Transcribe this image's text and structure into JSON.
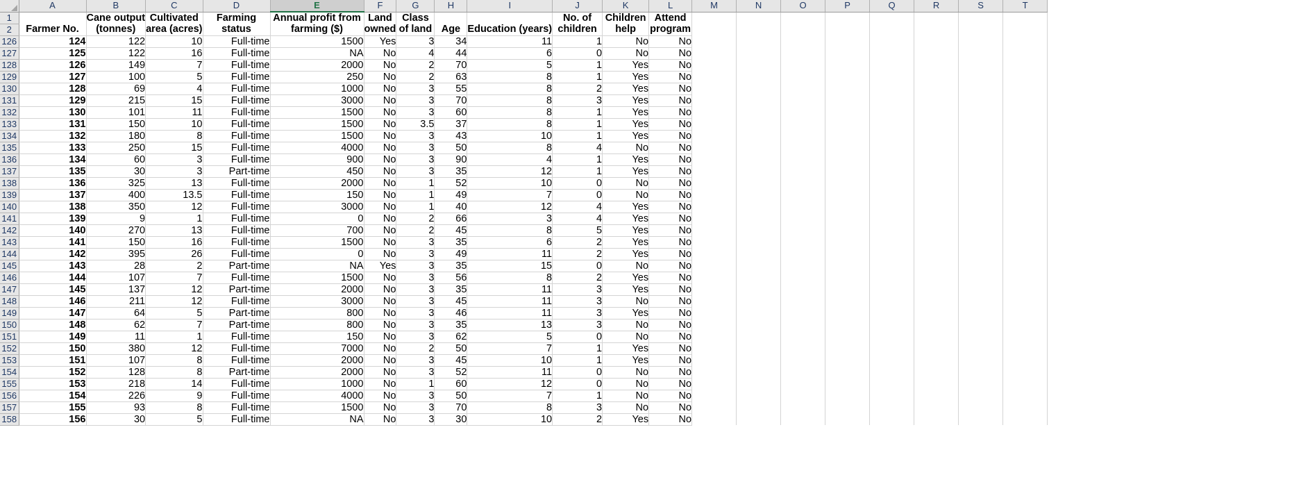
{
  "app": {
    "type": "spreadsheet",
    "select_all_icon": "select-all-triangle-icon",
    "selected_column": "E"
  },
  "columns": {
    "letters": [
      "A",
      "B",
      "C",
      "D",
      "E",
      "F",
      "G",
      "H",
      "I",
      "J",
      "K",
      "L",
      "M",
      "N",
      "O",
      "P",
      "Q",
      "R",
      "S",
      "T"
    ],
    "widths": [
      97,
      82,
      81,
      97,
      135,
      45,
      55,
      47,
      113,
      72,
      67,
      62,
      64,
      64,
      64,
      64,
      64,
      64,
      64,
      64
    ]
  },
  "header_rows": {
    "row1_number": "1",
    "row2_number": "2",
    "row1": [
      "",
      "Cane output",
      "Cultivated",
      "Farming",
      "Annual profit from",
      "Land",
      "Class",
      "",
      "",
      "No. of",
      "Children",
      "Attend"
    ],
    "row2": [
      "Farmer No.",
      "(tonnes)",
      "area (acres)",
      "status",
      "farming ($)",
      "owned",
      "of land",
      "Age",
      "Education (years)",
      "children",
      "help",
      "program"
    ]
  },
  "table": {
    "row_numbers": [
      "126",
      "127",
      "128",
      "129",
      "130",
      "131",
      "132",
      "133",
      "134",
      "135",
      "136",
      "137",
      "138",
      "139",
      "140",
      "141",
      "142",
      "143",
      "144",
      "145",
      "146",
      "147",
      "148",
      "149",
      "150",
      "151",
      "152",
      "153",
      "154",
      "155",
      "156",
      "157",
      "158"
    ],
    "rows": [
      [
        "124",
        "122",
        "10",
        "Full-time",
        "1500",
        "Yes",
        "3",
        "34",
        "11",
        "1",
        "No",
        "No"
      ],
      [
        "125",
        "122",
        "16",
        "Full-time",
        "NA",
        "No",
        "4",
        "44",
        "6",
        "0",
        "No",
        "No"
      ],
      [
        "126",
        "149",
        "7",
        "Full-time",
        "2000",
        "No",
        "2",
        "70",
        "5",
        "1",
        "Yes",
        "No"
      ],
      [
        "127",
        "100",
        "5",
        "Full-time",
        "250",
        "No",
        "2",
        "63",
        "8",
        "1",
        "Yes",
        "No"
      ],
      [
        "128",
        "69",
        "4",
        "Full-time",
        "1000",
        "No",
        "3",
        "55",
        "8",
        "2",
        "Yes",
        "No"
      ],
      [
        "129",
        "215",
        "15",
        "Full-time",
        "3000",
        "No",
        "3",
        "70",
        "8",
        "3",
        "Yes",
        "No"
      ],
      [
        "130",
        "101",
        "11",
        "Full-time",
        "1500",
        "No",
        "3",
        "60",
        "8",
        "1",
        "Yes",
        "No"
      ],
      [
        "131",
        "150",
        "10",
        "Full-time",
        "1500",
        "No",
        "3.5",
        "37",
        "8",
        "1",
        "Yes",
        "No"
      ],
      [
        "132",
        "180",
        "8",
        "Full-time",
        "1500",
        "No",
        "3",
        "43",
        "10",
        "1",
        "Yes",
        "No"
      ],
      [
        "133",
        "250",
        "15",
        "Full-time",
        "4000",
        "No",
        "3",
        "50",
        "8",
        "4",
        "No",
        "No"
      ],
      [
        "134",
        "60",
        "3",
        "Full-time",
        "900",
        "No",
        "3",
        "90",
        "4",
        "1",
        "Yes",
        "No"
      ],
      [
        "135",
        "30",
        "3",
        "Part-time",
        "450",
        "No",
        "3",
        "35",
        "12",
        "1",
        "Yes",
        "No"
      ],
      [
        "136",
        "325",
        "13",
        "Full-time",
        "2000",
        "No",
        "1",
        "52",
        "10",
        "0",
        "No",
        "No"
      ],
      [
        "137",
        "400",
        "13.5",
        "Full-time",
        "150",
        "No",
        "1",
        "49",
        "7",
        "0",
        "No",
        "No"
      ],
      [
        "138",
        "350",
        "12",
        "Full-time",
        "3000",
        "No",
        "1",
        "40",
        "12",
        "4",
        "Yes",
        "No"
      ],
      [
        "139",
        "9",
        "1",
        "Full-time",
        "0",
        "No",
        "2",
        "66",
        "3",
        "4",
        "Yes",
        "No"
      ],
      [
        "140",
        "270",
        "13",
        "Full-time",
        "700",
        "No",
        "2",
        "45",
        "8",
        "5",
        "Yes",
        "No"
      ],
      [
        "141",
        "150",
        "16",
        "Full-time",
        "1500",
        "No",
        "3",
        "35",
        "6",
        "2",
        "Yes",
        "No"
      ],
      [
        "142",
        "395",
        "26",
        "Full-time",
        "0",
        "No",
        "3",
        "49",
        "11",
        "2",
        "Yes",
        "No"
      ],
      [
        "143",
        "28",
        "2",
        "Part-time",
        "NA",
        "Yes",
        "3",
        "35",
        "15",
        "0",
        "No",
        "No"
      ],
      [
        "144",
        "107",
        "7",
        "Full-time",
        "1500",
        "No",
        "3",
        "56",
        "8",
        "2",
        "Yes",
        "No"
      ],
      [
        "145",
        "137",
        "12",
        "Part-time",
        "2000",
        "No",
        "3",
        "35",
        "11",
        "3",
        "Yes",
        "No"
      ],
      [
        "146",
        "211",
        "12",
        "Full-time",
        "3000",
        "No",
        "3",
        "45",
        "11",
        "3",
        "No",
        "No"
      ],
      [
        "147",
        "64",
        "5",
        "Part-time",
        "800",
        "No",
        "3",
        "46",
        "11",
        "3",
        "Yes",
        "No"
      ],
      [
        "148",
        "62",
        "7",
        "Part-time",
        "800",
        "No",
        "3",
        "35",
        "13",
        "3",
        "No",
        "No"
      ],
      [
        "149",
        "11",
        "1",
        "Full-time",
        "150",
        "No",
        "3",
        "62",
        "5",
        "0",
        "No",
        "No"
      ],
      [
        "150",
        "380",
        "12",
        "Full-time",
        "7000",
        "No",
        "2",
        "50",
        "7",
        "1",
        "Yes",
        "No"
      ],
      [
        "151",
        "107",
        "8",
        "Full-time",
        "2000",
        "No",
        "3",
        "45",
        "10",
        "1",
        "Yes",
        "No"
      ],
      [
        "152",
        "128",
        "8",
        "Part-time",
        "2000",
        "No",
        "3",
        "52",
        "11",
        "0",
        "No",
        "No"
      ],
      [
        "153",
        "218",
        "14",
        "Full-time",
        "1000",
        "No",
        "1",
        "60",
        "12",
        "0",
        "No",
        "No"
      ],
      [
        "154",
        "226",
        "9",
        "Full-time",
        "4000",
        "No",
        "3",
        "50",
        "7",
        "1",
        "No",
        "No"
      ],
      [
        "155",
        "93",
        "8",
        "Full-time",
        "1500",
        "No",
        "3",
        "70",
        "8",
        "3",
        "No",
        "No"
      ],
      [
        "156",
        "30",
        "5",
        "Full-time",
        "NA",
        "No",
        "3",
        "30",
        "10",
        "2",
        "Yes",
        "No"
      ]
    ]
  },
  "style": {
    "header_fill": "#e6e6e6",
    "selected_header_fill": "#cfcfcf",
    "selected_accent": "#217346",
    "header_text": "#1f3864",
    "gridline": "#d4d4d4"
  }
}
